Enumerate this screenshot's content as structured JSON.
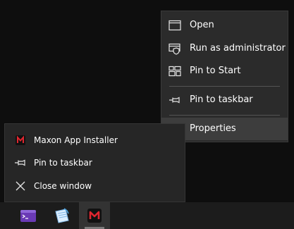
{
  "context_menu": {
    "items": [
      {
        "label": "Open",
        "icon": "window-icon"
      },
      {
        "label": "Run as administrator",
        "icon": "shield-icon"
      },
      {
        "label": "Pin to Start",
        "icon": "pin-to-start-icon"
      },
      {
        "label": "Pin to taskbar",
        "icon": "pin-icon"
      },
      {
        "label": "Properties",
        "icon": "wrench-icon",
        "highlighted": true
      }
    ]
  },
  "jump_list": {
    "app_name": "Maxon App Installer",
    "pin_label": "Pin to taskbar",
    "close_label": "Close window"
  },
  "taskbar": {
    "apps": [
      {
        "icon": "terminal-app-icon"
      },
      {
        "icon": "notepad-app-icon"
      },
      {
        "icon": "maxon-app-icon",
        "active": true
      }
    ]
  },
  "colors": {
    "menu_bg": "#2b2b2b",
    "menu_hover": "#3d3d3d",
    "jumplist_bg": "#262626",
    "taskbar_bg": "#1c1c1c",
    "maxon_red": "#e0262f"
  }
}
